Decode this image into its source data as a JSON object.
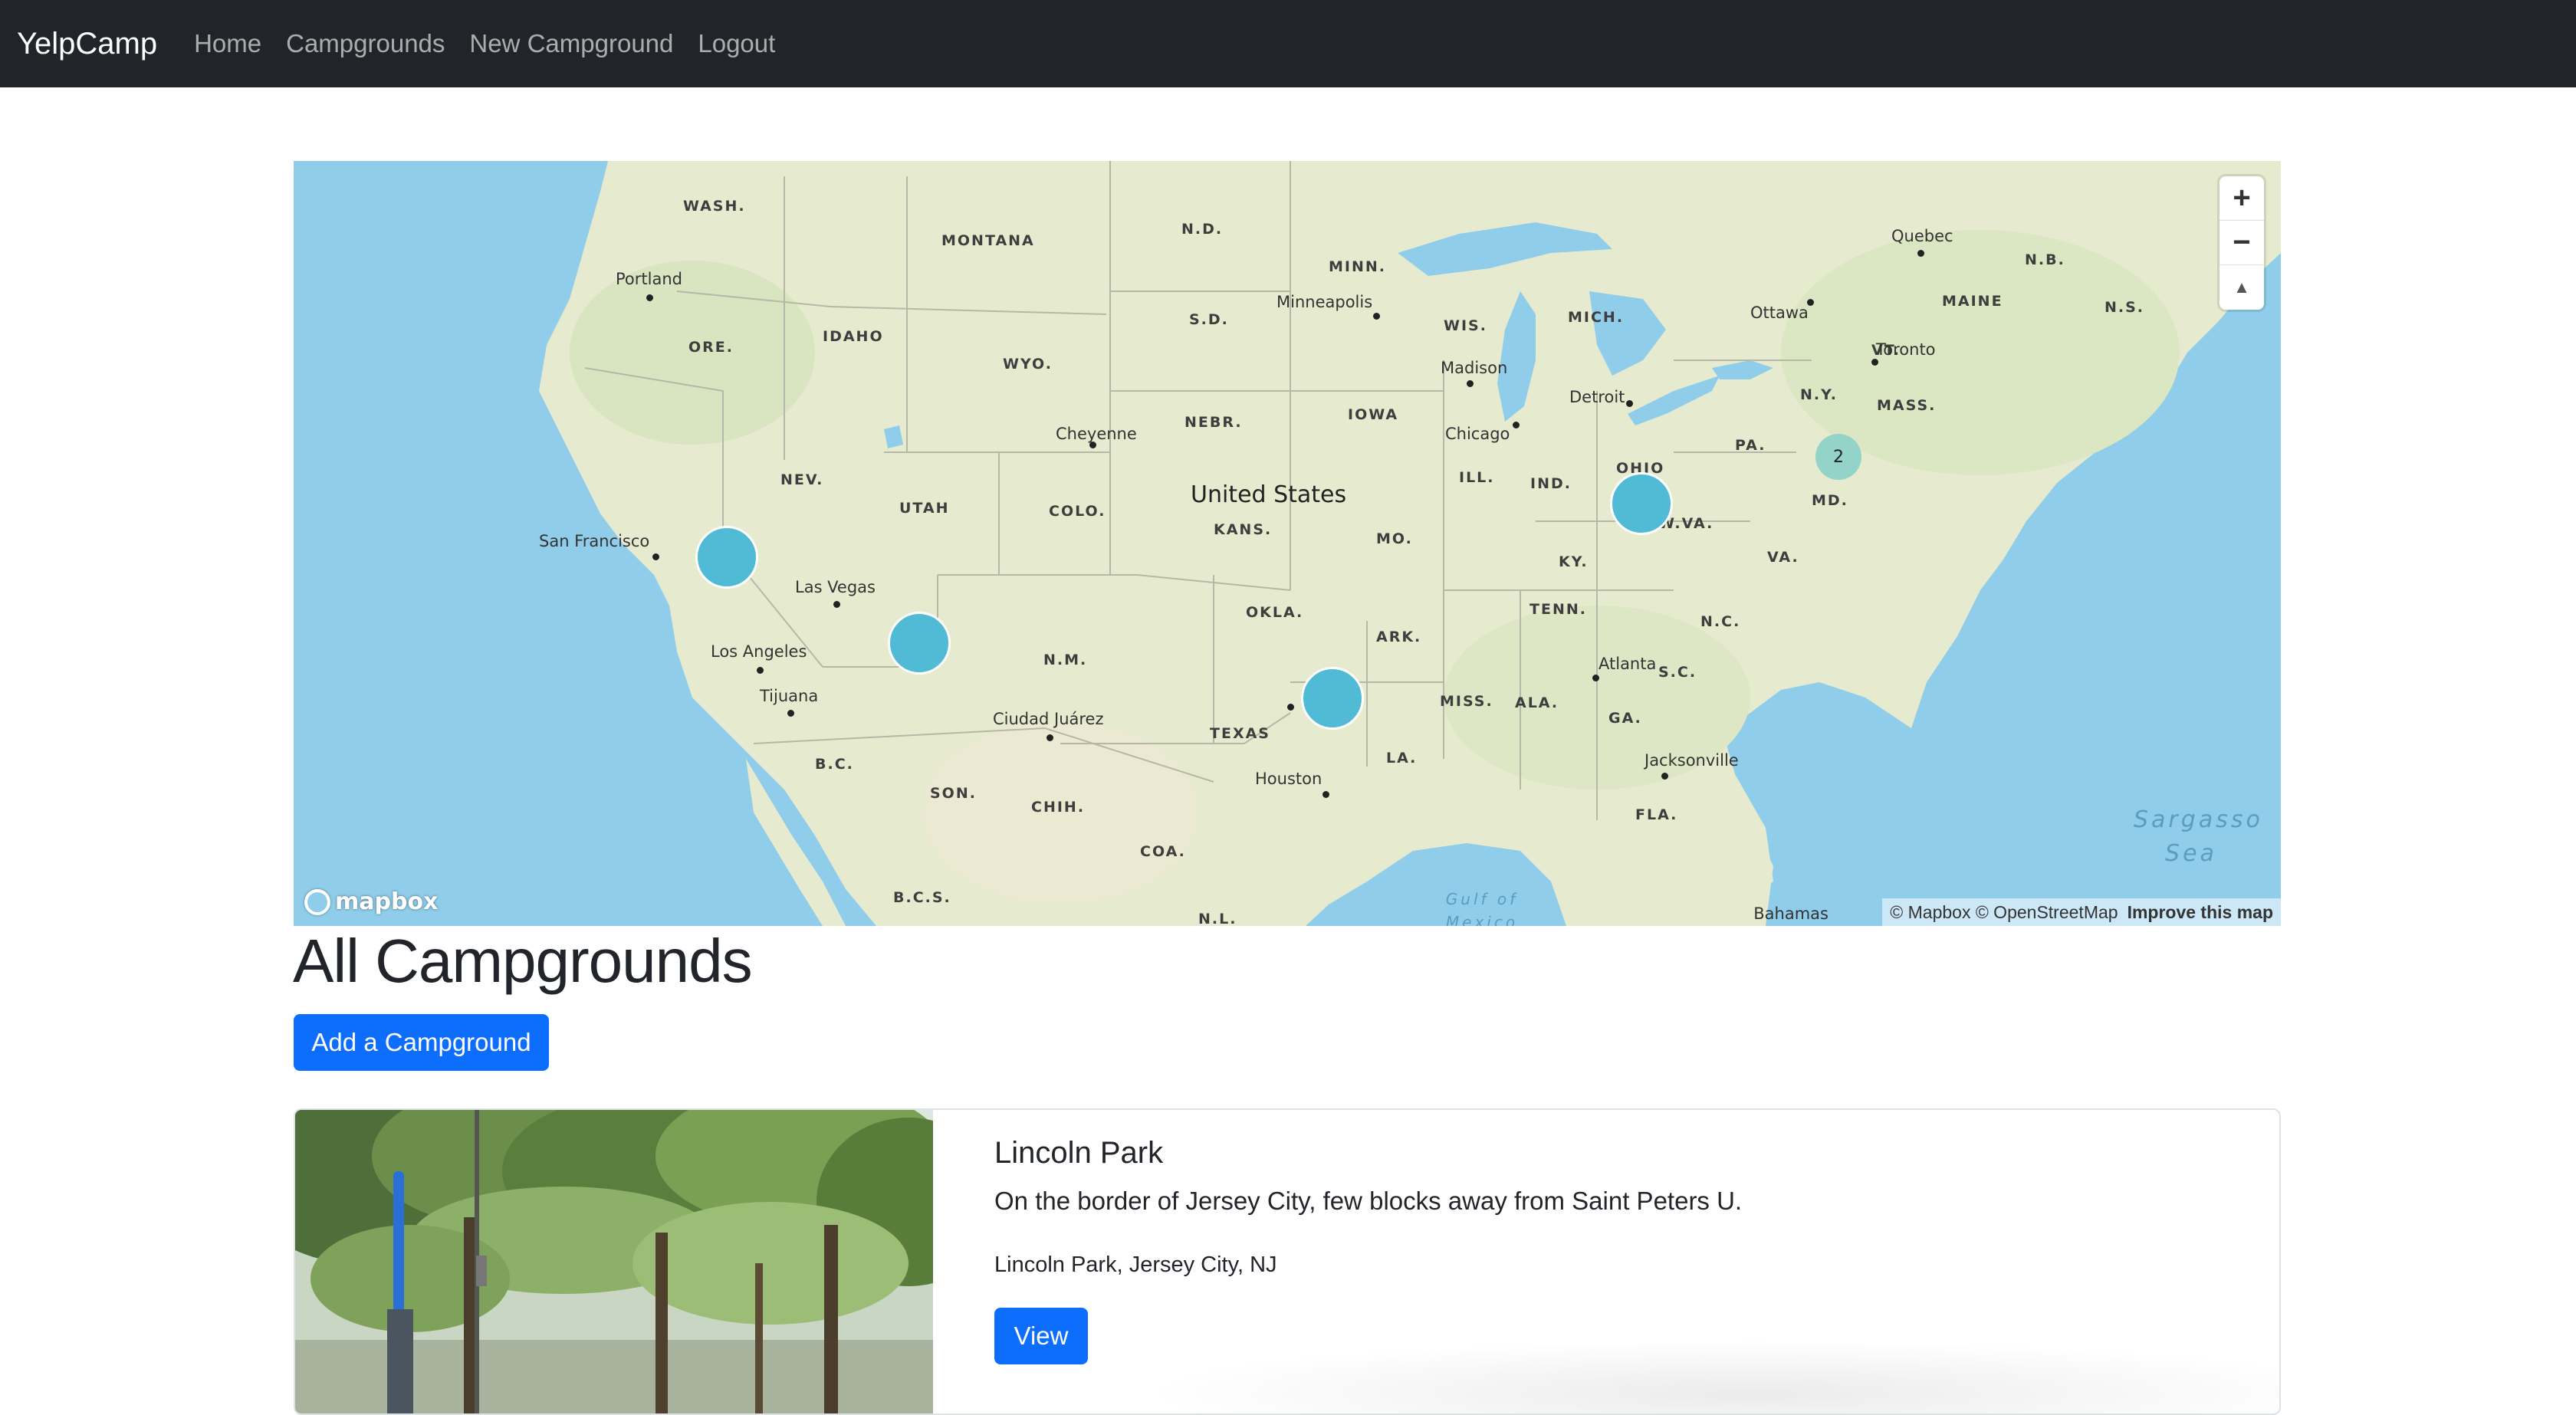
{
  "navbar": {
    "brand": "YelpCamp",
    "links": [
      {
        "label": "Home"
      },
      {
        "label": "Campgrounds"
      },
      {
        "label": "New Campground"
      },
      {
        "label": "Logout"
      }
    ],
    "background": "#212529"
  },
  "map": {
    "state_labels": [
      "WASH.",
      "MONTANA",
      "N.D.",
      "MINN.",
      "ORE.",
      "IDAHO",
      "S.D.",
      "WIS.",
      "MICH.",
      "WYO.",
      "NEBR.",
      "IOWA",
      "NEV.",
      "UTAH",
      "COLO.",
      "KANS.",
      "ILL.",
      "IND.",
      "OHIO",
      "PA.",
      "N.Y.",
      "VT.",
      "MAINE",
      "N.B.",
      "N.S.",
      "MASS.",
      "MD.",
      "W.VA.",
      "VA.",
      "KY.",
      "MO.",
      "OKLA.",
      "ARK.",
      "TENN.",
      "N.C.",
      "S.C.",
      "GA.",
      "ALA.",
      "MISS.",
      "LA.",
      "TEXAS",
      "N.M.",
      "FLA.",
      "B.C.",
      "SON.",
      "CHIH.",
      "COA.",
      "B.C.S.",
      "N.L."
    ],
    "cities": [
      "Portland",
      "Minneapolis",
      "Ottawa",
      "Quebec",
      "Toronto",
      "Madison",
      "Detroit",
      "Chicago",
      "Cheyenne",
      "San Francisco",
      "Las Vegas",
      "Los Angeles",
      "Tijuana",
      "Ciudad Juárez",
      "Houston",
      "Atlanta",
      "Jacksonville"
    ],
    "country_label": "United States",
    "water_labels": [
      "Sargasso Sea",
      "Gulf of Mexico"
    ],
    "bahamas_label": "Bahamas",
    "cluster_count_label": "2",
    "zoom_in": "+",
    "zoom_out": "−",
    "compass": "▲",
    "logo_text": "mapbox",
    "attribution": "© Mapbox © OpenStreetMap",
    "improve_link": "Improve this map",
    "colors": {
      "water": "#8fcdea",
      "land": "#e6ebcf",
      "cluster": "#51bbd6",
      "cluster_small": "#94d3c7"
    }
  },
  "page": {
    "title": "All Campgrounds",
    "add_button": "Add a Campground"
  },
  "campgrounds": [
    {
      "title": "Lincoln Park",
      "description": "On the border of Jersey City, few blocks away from Saint Peters U.",
      "location": "Lincoln Park, Jersey City, NJ",
      "view_button": "View"
    }
  ],
  "colors": {
    "primary": "#0d6efd"
  }
}
